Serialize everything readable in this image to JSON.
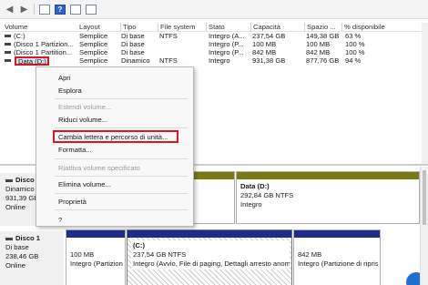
{
  "toolbar": {
    "back_icon": "arrow-left-icon",
    "forward_icon": "arrow-right-icon",
    "help_glyph": "?"
  },
  "volumes": {
    "columns": [
      "Volume",
      "Layout",
      "Tipo",
      "File system",
      "Stato",
      "Capacità",
      "Spazio ...",
      "% disponibile"
    ],
    "rows": [
      {
        "volume": "(C:)",
        "layout": "Semplice",
        "tipo": "Di base",
        "fs": "NTFS",
        "stato": "Integro (A...",
        "capacita": "237,54 GB",
        "spazio": "149,38 GB",
        "perc": "63 %"
      },
      {
        "volume": "(Disco 1 Partizion...",
        "layout": "Semplice",
        "tipo": "Di base",
        "fs": "",
        "stato": "Integro (P...",
        "capacita": "100 MB",
        "spazio": "100 MB",
        "perc": "100 %"
      },
      {
        "volume": "(Disco 1 Partition...",
        "layout": "Semplice",
        "tipo": "Di base",
        "fs": "",
        "stato": "Integro (P...",
        "capacita": "842 MB",
        "spazio": "842 MB",
        "perc": "100 %"
      },
      {
        "volume": "Data (D:)",
        "layout": "Semplice",
        "tipo": "Dinamico",
        "fs": "NTFS",
        "stato": "Integro",
        "capacita": "931,38 GB",
        "spazio": "877,76 GB",
        "perc": "94 %"
      }
    ]
  },
  "context_menu": {
    "apri": "Apri",
    "esplora": "Esplora",
    "estendi": "Estendi volume...",
    "riduci": "Riduci volume...",
    "cambia": "Cambia lettera e percorso di unità...",
    "formatta": "Formatta...",
    "riattiva": "Riattiva volume specificato",
    "elimina": "Elimina volume...",
    "proprieta": "Proprietà",
    "help": "?"
  },
  "disks": [
    {
      "name": "Disco",
      "type": "Dinamico",
      "size": "931,39 GB",
      "status": "Online",
      "partitions": [
        {
          "title": "Data  (D:)",
          "size": "292,84 GB NTFS",
          "status": "Integro"
        }
      ]
    },
    {
      "name": "Disco 1",
      "type": "Di base",
      "size": "238,46 GB",
      "status": "Online",
      "partitions": [
        {
          "title": "",
          "size": "100 MB",
          "status": "Integro (Partizion"
        },
        {
          "title": "(C:)",
          "size": "237,54 GB NTFS",
          "status": "Integro (Avvio, File di paging, Dettagli arresto anom"
        },
        {
          "title": "",
          "size": "842 MB",
          "status": "Integro (Partizione di riprist"
        }
      ]
    }
  ],
  "colors": {
    "selection_highlight": "#e0141e",
    "partition_bar_dynamic": "#7a7a14",
    "partition_bar_basic": "#1f2c8c"
  }
}
